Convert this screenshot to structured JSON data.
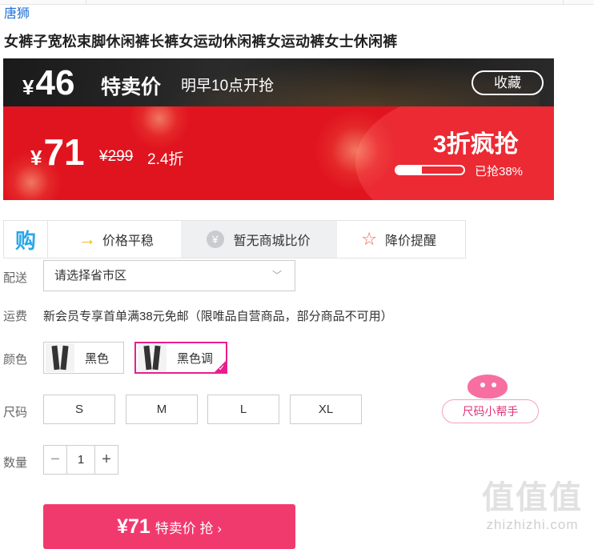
{
  "brand": "唐狮",
  "product_title": "女裤子宽松束脚休闲裤长裤女运动休闲裤女运动裤女士休闲裤",
  "presale": {
    "currency": "¥",
    "price": "46",
    "label": "特卖价",
    "time_note": "明早10点开抢",
    "collect_label": "收藏"
  },
  "flash_sale": {
    "currency": "¥",
    "price": "71",
    "original_price": "¥299",
    "discount": "2.4折",
    "label": "3折疯抢",
    "progress_fraction": 0.38,
    "progress_text": "已抢38%"
  },
  "price_tools": {
    "logo_glyph": "购",
    "trend_label": "价格平稳",
    "compare_label": "暂无商城比价",
    "alert_label": "降价提醒",
    "icons": [
      "gou-logo-icon",
      "arrow-right-icon",
      "yen-coin-icon",
      "star-outline-icon"
    ]
  },
  "delivery": {
    "label": "配送",
    "select_value": "请选择省市区"
  },
  "shipping": {
    "label": "运费",
    "text": "新会员专享首单满38元免邮（限唯品自营商品，部分商品不可用）"
  },
  "color": {
    "label": "颜色",
    "options": [
      {
        "label": "黑色",
        "selected": false
      },
      {
        "label": "黑色调",
        "selected": true
      }
    ]
  },
  "size": {
    "label": "尺码",
    "options": [
      "S",
      "M",
      "L",
      "XL"
    ],
    "helper_label": "尺码小帮手"
  },
  "quantity": {
    "label": "数量",
    "value": "1",
    "minus": "−",
    "plus": "+"
  },
  "buy_button": {
    "price": "¥71",
    "label": "特卖价 抢 ›"
  },
  "watermark": {
    "logo": "值值值",
    "url": "zhizhizhi.com"
  },
  "colors": {
    "flash_red": "#e0141f",
    "accent_pink": "#f03a6e",
    "brand_blue": "#1e6fd9",
    "selected_magenta": "#e91e8c"
  }
}
